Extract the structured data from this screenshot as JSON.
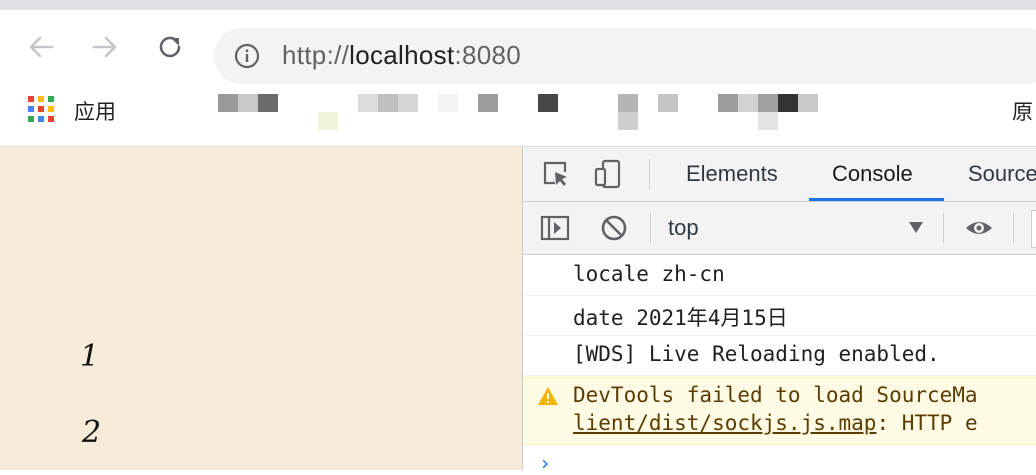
{
  "browser": {
    "url": {
      "scheme": "http://",
      "host": "localhost",
      "port": ":8080"
    },
    "bookmarks": {
      "apps_label": "应用",
      "right_partial": "原"
    }
  },
  "page": {
    "items": [
      "1",
      "2"
    ]
  },
  "devtools": {
    "tabs": [
      "Elements",
      "Console",
      "Source"
    ],
    "active_tab": "Console",
    "context": "top",
    "messages": [
      {
        "type": "log",
        "text": "locale zh-cn"
      },
      {
        "type": "log",
        "text": "date 2021年4月15日"
      },
      {
        "type": "log",
        "text": "[WDS] Live Reloading enabled."
      }
    ],
    "warning": {
      "line1": "DevTools failed to load SourceMa",
      "line2_link": "lient/dist/sockjs.js.map",
      "line2_rest": ": HTTP e"
    },
    "prompt": "›"
  },
  "colors": {
    "accent": "#1a73e8",
    "page_bg": "#f6ead9",
    "warning_bg": "#fffbe5"
  }
}
